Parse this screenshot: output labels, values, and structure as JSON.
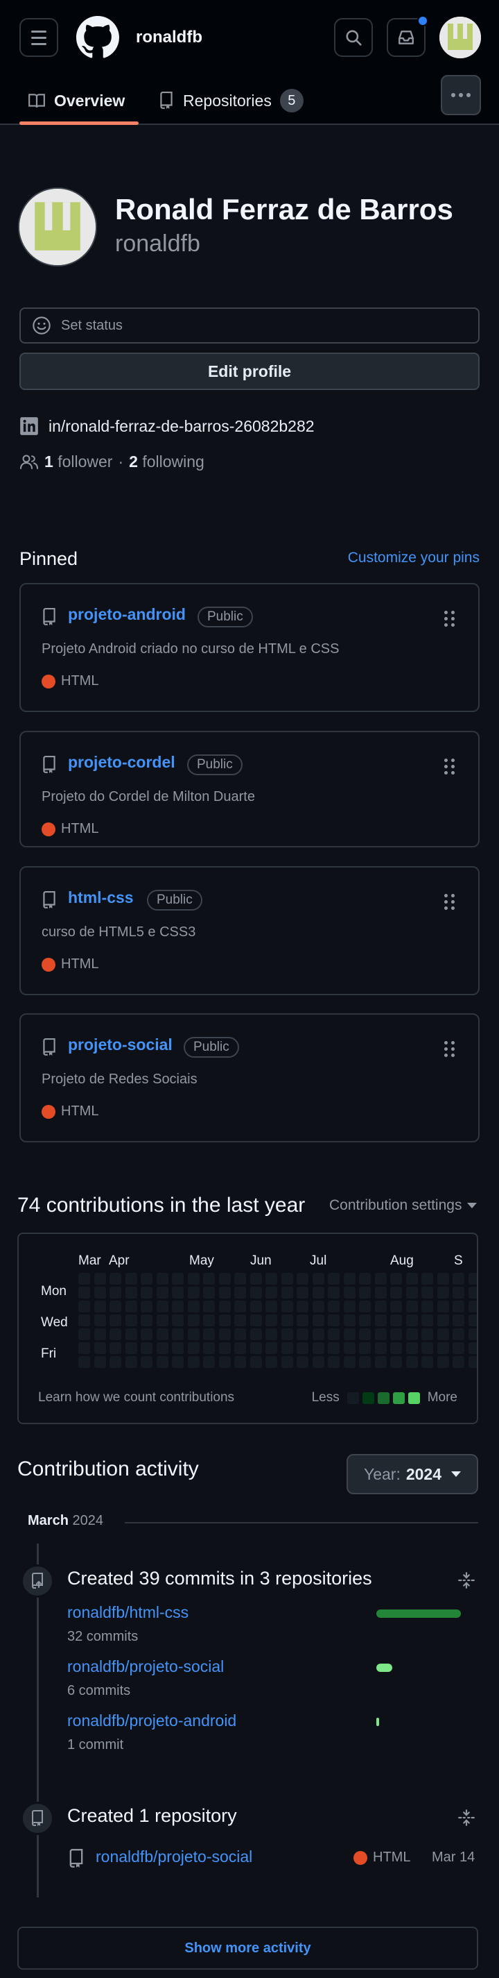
{
  "colors": {
    "bg": "#0d1117",
    "header_bg": "#010409",
    "accent": "#4493f8",
    "tab_underline": "#f78166",
    "html_lang": "#e34c26",
    "bar_green": "#238636",
    "bar_light": "#7ee787",
    "notification": "#2f81f7"
  },
  "header": {
    "menu_icon": "hamburger-icon",
    "logo_icon": "github-mark-icon",
    "username": "ronaldfb",
    "search_icon": "search-icon",
    "inbox_icon": "inbox-icon"
  },
  "tabs": {
    "overview_label": "Overview",
    "repositories_label": "Repositories",
    "repositories_count": "5",
    "more_icon": "kebab-horizontal-icon"
  },
  "profile": {
    "name": "Ronald Ferraz de Barros",
    "login": "ronaldfb",
    "set_status": "Set status",
    "edit_profile": "Edit profile",
    "linkedin": "in/ronald-ferraz-de-barros-26082b282",
    "followers_count": "1",
    "followers_label": "follower",
    "separator": "·",
    "following_count": "2",
    "following_label": "following"
  },
  "pinned": {
    "title": "Pinned",
    "customize": "Customize your pins",
    "repos": [
      {
        "name": "projeto-android",
        "visibility": "Public",
        "description": "Projeto Android criado no curso de HTML e CSS",
        "language": "HTML"
      },
      {
        "name": "projeto-cordel",
        "visibility": "Public",
        "description": "Projeto do Cordel de Milton Duarte",
        "language": "HTML"
      },
      {
        "name": "html-css",
        "visibility": "Public",
        "description": "curso de HTML5 e CSS3",
        "language": "HTML"
      },
      {
        "name": "projeto-social",
        "visibility": "Public",
        "description": "Projeto de Redes Sociais",
        "language": "HTML"
      }
    ]
  },
  "contributions": {
    "title": "74 contributions in the last year",
    "settings": "Contribution settings",
    "months": [
      "Mar",
      "Apr",
      "May",
      "Jun",
      "Jul",
      "Aug",
      "S"
    ],
    "days": [
      "Mon",
      "Wed",
      "Fri"
    ],
    "learn": "Learn how we count contributions",
    "less": "Less",
    "more": "More",
    "legend_colors": [
      "#151b23",
      "#033a16",
      "#196c2e",
      "#2ea043",
      "#56d364"
    ]
  },
  "activity": {
    "title": "Contribution activity",
    "year_label": "Year:",
    "year_value": "2024",
    "month": "March",
    "month_year": "2024",
    "commits_heading": "Created 39 commits in 3 repositories",
    "commit_repos": [
      {
        "name": "ronaldfb/html-css",
        "count": "32 commits",
        "commits": 32
      },
      {
        "name": "ronaldfb/projeto-social",
        "count": "6 commits",
        "commits": 6
      },
      {
        "name": "ronaldfb/projeto-android",
        "count": "1 commit",
        "commits": 1
      }
    ],
    "repo_heading": "Created 1 repository",
    "created_repo": "ronaldfb/projeto-social",
    "created_lang": "HTML",
    "created_date": "Mar 14",
    "show_more": "Show more activity"
  }
}
